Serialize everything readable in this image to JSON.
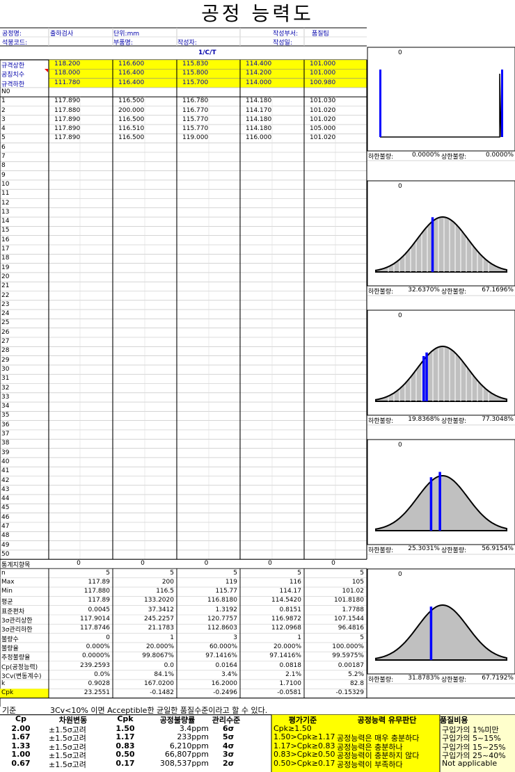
{
  "title": "공정 능력도",
  "header": {
    "process_label": "공정명:",
    "process_value": "출하검사",
    "unit_label": "단위:mm",
    "dept_label": "작성부서:",
    "dept_value": "품질팀",
    "code_label": "석붕코드:",
    "part_label": "부품명:",
    "author_label": "작성자:",
    "date_label": "작성일:"
  },
  "column_header": "1/C/T",
  "spec_rows": [
    {
      "label": "규격상한",
      "values": [
        "118.200",
        "116.600",
        "115.830",
        "114.400",
        "101.000"
      ]
    },
    {
      "label": "공칭치수",
      "values": [
        "118.000",
        "116.400",
        "115.800",
        "114.200",
        "101.000"
      ]
    },
    {
      "label": "규격하한",
      "values": [
        "111.780",
        "116.400",
        "115.700",
        "114.000",
        "100.980"
      ]
    }
  ],
  "no_label": "N0",
  "data_rows": [
    [
      "117.890",
      "116.500",
      "116.780",
      "114.180",
      "101.030"
    ],
    [
      "117.880",
      "200.000",
      "116.770",
      "114.170",
      "101.020"
    ],
    [
      "117.890",
      "116.500",
      "115.770",
      "114.180",
      "101.020"
    ],
    [
      "117.890",
      "116.510",
      "115.770",
      "114.180",
      "105.000"
    ],
    [
      "117.890",
      "116.500",
      "119.000",
      "116.000",
      "101.020"
    ]
  ],
  "stat_label": "통계지향목",
  "stat_values": [
    "0",
    "0",
    "0",
    "0",
    "0"
  ],
  "stats": [
    {
      "label": "n",
      "values": [
        "5",
        "5",
        "5",
        "5",
        "5"
      ]
    },
    {
      "label": "Max",
      "values": [
        "117.89",
        "200",
        "119",
        "116",
        "105"
      ]
    },
    {
      "label": "Min",
      "values": [
        "117.880",
        "116.5",
        "115.77",
        "114.17",
        "101.02"
      ]
    },
    {
      "label": "평균",
      "values": [
        "117.89",
        "133.2020",
        "116.8180",
        "114.5420",
        "101.8180"
      ]
    },
    {
      "label": "표준편차",
      "values": [
        "0.0045",
        "37.3412",
        "1.3192",
        "0.8151",
        "1.7788"
      ]
    },
    {
      "label": "3σ관리상한",
      "values": [
        "117.9014",
        "245.2257",
        "120.7757",
        "116.9872",
        "107.1544"
      ]
    },
    {
      "label": "3σ관리하한",
      "values": [
        "117.8746",
        "21.1783",
        "112.8603",
        "112.0968",
        "96.4816"
      ]
    },
    {
      "label": "불량수",
      "values": [
        "0",
        "1",
        "3",
        "1",
        "5"
      ]
    },
    {
      "label": "불량율",
      "values": [
        "0.000%",
        "20.000%",
        "60.000%",
        "20.000%",
        "100.000%"
      ]
    },
    {
      "label": "추정불량율",
      "values": [
        "0.0000%",
        "99.8067%",
        "97.1416%",
        "97.1416%",
        "99.5975%"
      ]
    },
    {
      "label": "Cp(공정능력)",
      "values": [
        "239.2593",
        "0.0",
        "0.0164",
        "0.0818",
        "0.00187"
      ]
    },
    {
      "label": "3Cv(변동계수)",
      "values": [
        "0.0%",
        "84.1%",
        "3.4%",
        "2.1%",
        "5.2%"
      ]
    },
    {
      "label": "k",
      "values": [
        "0.9028",
        "167.0200",
        "16.2000",
        "1.7100",
        "82.8"
      ]
    },
    {
      "label": "Cpk",
      "values": [
        "23.2551",
        "-0.1482",
        "-0.2496",
        "-0.0581",
        "-0.15329"
      ]
    }
  ],
  "charts": [
    {
      "top_label": "0",
      "low_label": "하한불량:",
      "low_value": "0.0000%",
      "high_label": "상한불량:",
      "high_value": "0.0000%",
      "type": "flat"
    },
    {
      "top_label": "0",
      "low_label": "하한불량:",
      "low_value": "32.6370%",
      "high_label": "상한불량:",
      "high_value": "67.1696%",
      "type": "bell",
      "bars": [
        0.44
      ]
    },
    {
      "top_label": "0",
      "low_label": "하한불량:",
      "low_value": "19.8368%",
      "high_label": "상한불량:",
      "high_value": "77.3048%",
      "type": "bell",
      "bars": [
        0.38,
        0.4
      ]
    },
    {
      "top_label": "0",
      "low_label": "하한불량:",
      "low_value": "25.3031%",
      "high_label": "상한불량:",
      "high_value": "56.9154%",
      "type": "bell",
      "bars": [
        0.43,
        0.49
      ]
    },
    {
      "top_label": "0",
      "low_label": "하한불량:",
      "low_value": "31.8783%",
      "high_label": "상한불량:",
      "high_value": "67.7192%",
      "type": "bell",
      "bars": [
        0.43
      ]
    }
  ],
  "footer": {
    "criteria_label": "기준",
    "criteria_text": "3Cv<10% 이면 Acceptible한 균일한 품질수준이라고 할 수 있다.",
    "col_headers": [
      "Cp",
      "차원변동",
      "Cpk",
      "공정불량률",
      "관리수준",
      "평가기준",
      "공정능력 유무판단",
      "품질비용"
    ],
    "rows": [
      [
        "2.00",
        "±1.5σ고려",
        "1.50",
        "3.4ppm",
        "6σ",
        "Cpk≥1.50",
        "",
        "구입가의 1%미만"
      ],
      [
        "1.67",
        "±1.5σ고려",
        "1.17",
        "233ppm",
        "5σ",
        "1.50>Cpk≥1.17",
        "공정능력은 매우 충분하다",
        "구입가의 5~15%"
      ],
      [
        "1.33",
        "±1.5σ고려",
        "0.83",
        "6,210ppm",
        "4σ",
        "1.17>Cpk≥0.83",
        "공정능력은 충분하나",
        "구입가의 15~25%"
      ],
      [
        "1.00",
        "±1.5σ고려",
        "0.50",
        "66,807ppm",
        "3σ",
        "0.83>Cpk≥0.50",
        "공정능력이 충분하지 않다",
        "구입가의 25~40%"
      ],
      [
        "0.67",
        "±1.5σ고려",
        "0.17",
        "308,537ppm",
        "2σ",
        "0.50>Cpk≥0.17",
        "공정능력이 부족하다",
        "Not applicable"
      ]
    ]
  },
  "colors": {
    "highlight": "#ffff00",
    "label_blue": "#0000aa",
    "bar_blue": "#0000ff",
    "curve_fill": "#c0c0c0"
  }
}
